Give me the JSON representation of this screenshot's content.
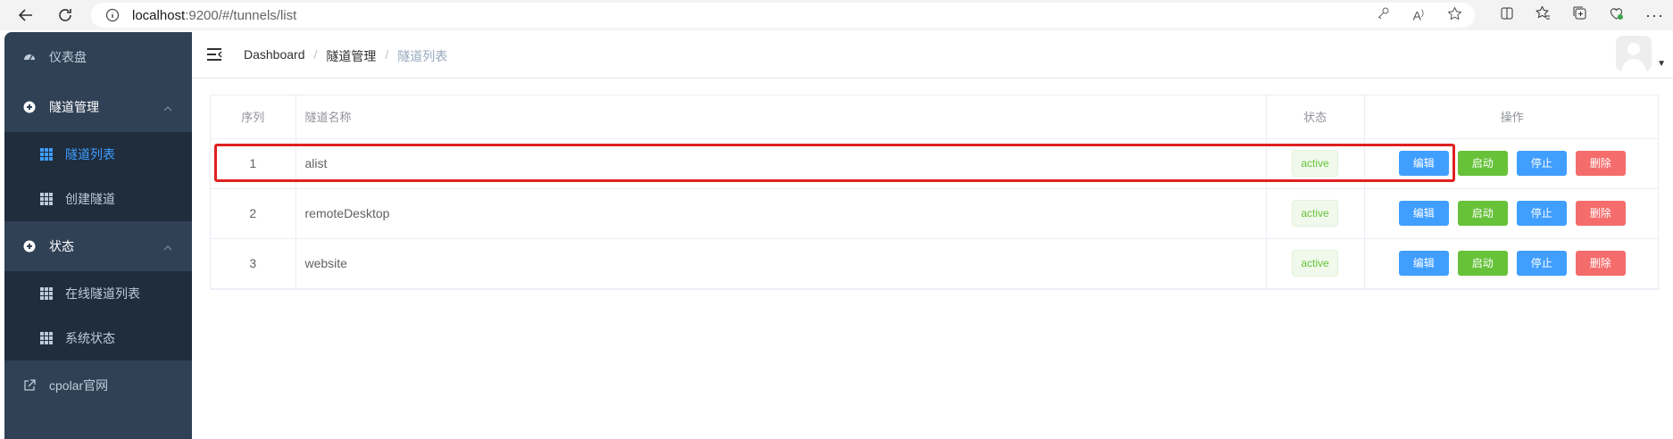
{
  "browser": {
    "url_host": "localhost",
    "url_path": ":9200/#/tunnels/list"
  },
  "sidebar": {
    "items": [
      {
        "label": "仪表盘",
        "icon": "dashboard-icon"
      },
      {
        "label": "隧道管理",
        "icon": "circle-plus-icon",
        "expanded": true,
        "children": [
          {
            "label": "隧道列表",
            "active": true
          },
          {
            "label": "创建隧道"
          }
        ]
      },
      {
        "label": "状态",
        "icon": "circle-plus-icon",
        "expanded": true,
        "children": [
          {
            "label": "在线隧道列表"
          },
          {
            "label": "系统状态"
          }
        ]
      },
      {
        "label": "cpolar官网",
        "icon": "external-link-icon"
      }
    ]
  },
  "breadcrumb": {
    "items": [
      "Dashboard",
      "隧道管理",
      "隧道列表"
    ]
  },
  "table": {
    "headers": [
      "序列",
      "隧道名称",
      "状态",
      "操作"
    ],
    "rows": [
      {
        "index": "1",
        "name": "alist",
        "status": "active"
      },
      {
        "index": "2",
        "name": "remoteDesktop",
        "status": "active"
      },
      {
        "index": "3",
        "name": "website",
        "status": "active"
      }
    ],
    "actions": {
      "edit": "编辑",
      "start": "启动",
      "stop": "停止",
      "delete": "删除"
    }
  },
  "colors": {
    "sidebar_bg": "#304156",
    "submenu_bg": "#1f2d3d",
    "active_text": "#409eff",
    "primary": "#409eff",
    "success": "#67c23a",
    "danger": "#f56c6c",
    "highlight": "#e02020"
  }
}
